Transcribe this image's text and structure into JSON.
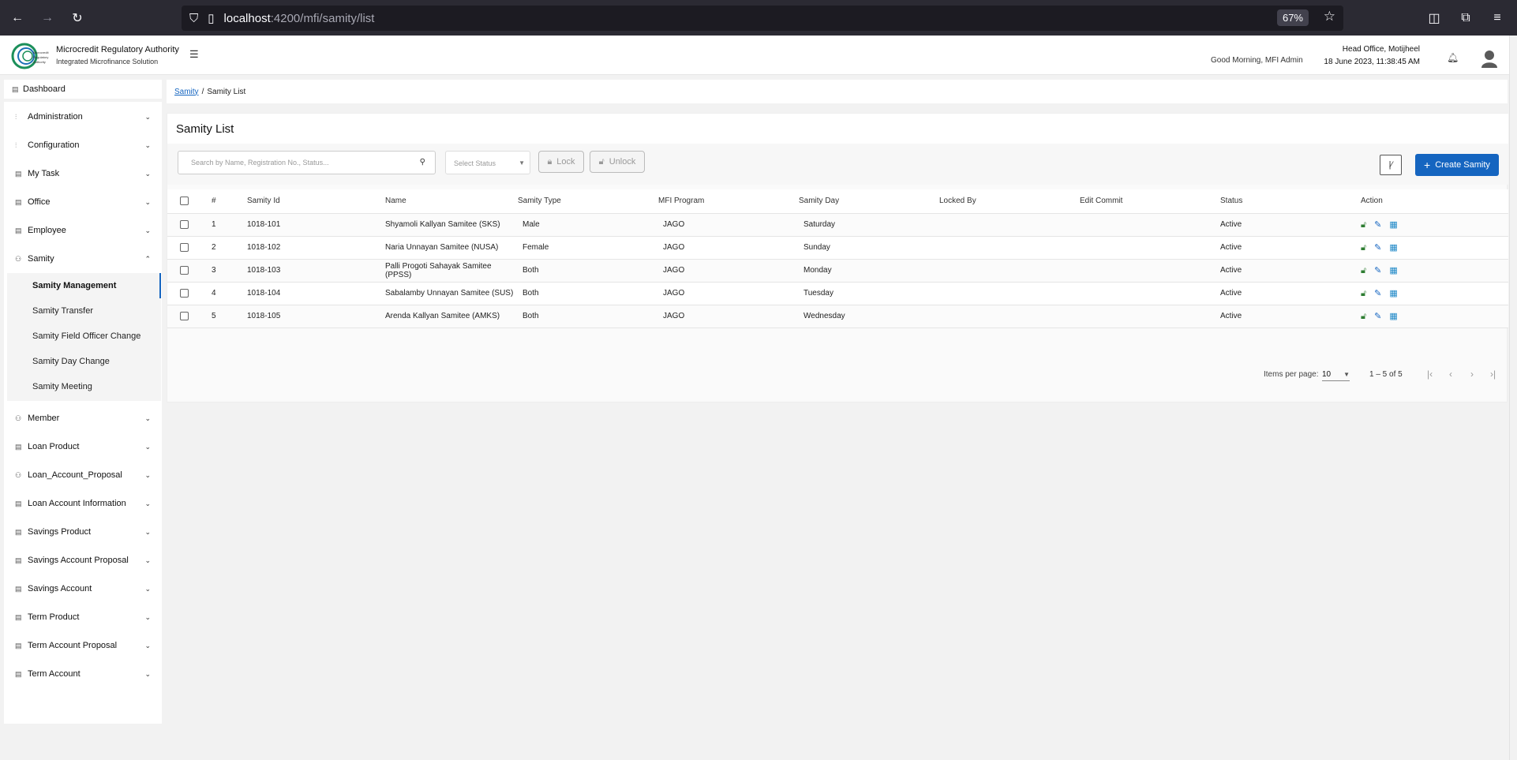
{
  "browser": {
    "url_host": "localhost",
    "url_path": ":4200/mfi/samity/list",
    "zoom": "67%"
  },
  "header": {
    "brand_title": "Microcredit Regulatory Authority",
    "brand_subtitle": "Integrated Microfinance Solution",
    "greeting": "Good Morning, MFI Admin",
    "office": "Head Office, Motijheel",
    "datetime": "18 June 2023, 11:38:45 AM",
    "logo_text": "Microcredit Regulatory Authority"
  },
  "sidebar": {
    "dashboard": "Dashboard",
    "items": [
      {
        "label": "Administration",
        "icon": "sliders-icon"
      },
      {
        "label": "Configuration",
        "icon": "sliders-icon"
      },
      {
        "label": "My Task",
        "icon": "task-icon"
      },
      {
        "label": "Office",
        "icon": "office-icon"
      },
      {
        "label": "Employee",
        "icon": "employee-icon"
      },
      {
        "label": "Samity",
        "icon": "samity-icon"
      },
      {
        "label": "Member",
        "icon": "member-icon"
      },
      {
        "label": "Loan Product",
        "icon": "loan-icon"
      },
      {
        "label": "Loan_Account_Proposal",
        "icon": "proposal-icon"
      },
      {
        "label": "Loan Account Information",
        "icon": "loan-icon"
      },
      {
        "label": "Savings Product",
        "icon": "savings-icon"
      },
      {
        "label": "Savings Account Proposal",
        "icon": "savings-icon"
      },
      {
        "label": "Savings Account",
        "icon": "savings-icon"
      },
      {
        "label": "Term Product",
        "icon": "term-icon"
      },
      {
        "label": "Term Account Proposal",
        "icon": "term-icon"
      },
      {
        "label": "Term Account",
        "icon": "term-icon"
      }
    ],
    "samity_submenu": [
      {
        "label": "Samity Management",
        "active": true
      },
      {
        "label": "Samity Transfer"
      },
      {
        "label": "Samity Field Officer Change"
      },
      {
        "label": "Samity Day Change"
      },
      {
        "label": "Samity Meeting"
      }
    ]
  },
  "breadcrumb": {
    "parent": "Samity",
    "separator": "/",
    "current": "Samity List"
  },
  "main": {
    "title": "Samity List",
    "search_placeholder": "Search by Name, Registration No., Status...",
    "status_placeholder": "Select Status",
    "lock_label": "Lock",
    "unlock_label": "Unlock",
    "create_label": "Create Samity"
  },
  "table": {
    "headers": [
      "#",
      "Samity Id",
      "Name",
      "Samity Type",
      "MFI Program",
      "Samity Day",
      "Locked By",
      "Edit Commit",
      "Status",
      "Action"
    ],
    "rows": [
      {
        "no": "1",
        "id": "1018-101",
        "name": "Shyamoli Kallyan Samitee (SKS)",
        "type": "Male",
        "program": "JAGO",
        "day": "Saturday",
        "locked_by": "",
        "edit_commit": "",
        "status": "Active"
      },
      {
        "no": "2",
        "id": "1018-102",
        "name": "Naria Unnayan Samitee (NUSA)",
        "type": "Female",
        "program": "JAGO",
        "day": "Sunday",
        "locked_by": "",
        "edit_commit": "",
        "status": "Active"
      },
      {
        "no": "3",
        "id": "1018-103",
        "name": "Palli Progoti Sahayak Samitee (PPSS)",
        "type": "Both",
        "program": "JAGO",
        "day": "Monday",
        "locked_by": "",
        "edit_commit": "",
        "status": "Active"
      },
      {
        "no": "4",
        "id": "1018-104",
        "name": "Sabalamby Unnayan Samitee (SUS)",
        "type": "Both",
        "program": "JAGO",
        "day": "Tuesday",
        "locked_by": "",
        "edit_commit": "",
        "status": "Active"
      },
      {
        "no": "5",
        "id": "1018-105",
        "name": "Arenda Kallyan Samitee (AMKS)",
        "type": "Both",
        "program": "JAGO",
        "day": "Wednesday",
        "locked_by": "",
        "edit_commit": "",
        "status": "Active"
      }
    ]
  },
  "paginator": {
    "items_label": "Items per page:",
    "page_size": "10",
    "range": "1 – 5 of 5"
  },
  "colors": {
    "primary": "#1565c0",
    "lock_green": "#2e7d32"
  }
}
